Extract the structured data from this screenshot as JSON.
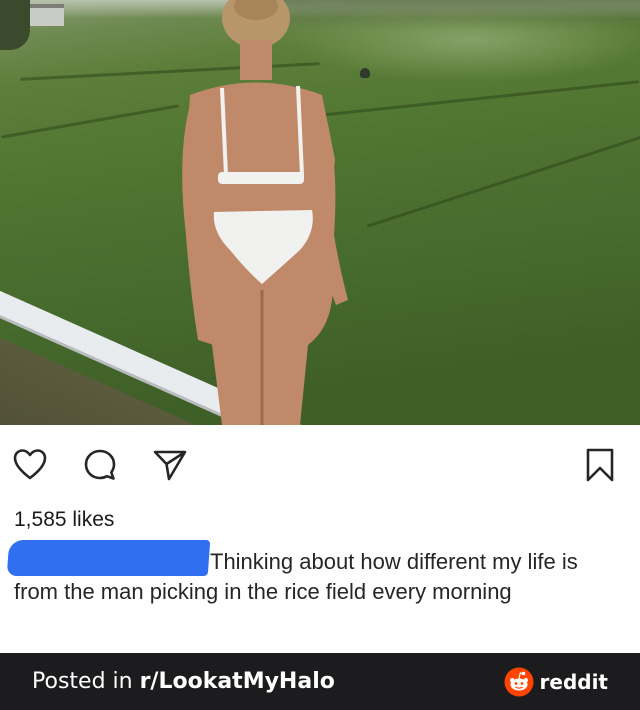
{
  "post": {
    "photo_alt": "",
    "likes": "1,585 likes",
    "username_redacted": true,
    "caption_line1": "Thinking about how different my life",
    "caption_rest": "is from the man picking in the rice field every morning"
  },
  "actions": {
    "like_icon": "heart-icon",
    "comment_icon": "comment-icon",
    "share_icon": "send-icon",
    "save_icon": "bookmark-icon"
  },
  "footer": {
    "posted_prefix": "Posted in ",
    "subreddit": "r/LookatMyHalo",
    "brand": "reddit",
    "brand_color": "#ff4500"
  }
}
